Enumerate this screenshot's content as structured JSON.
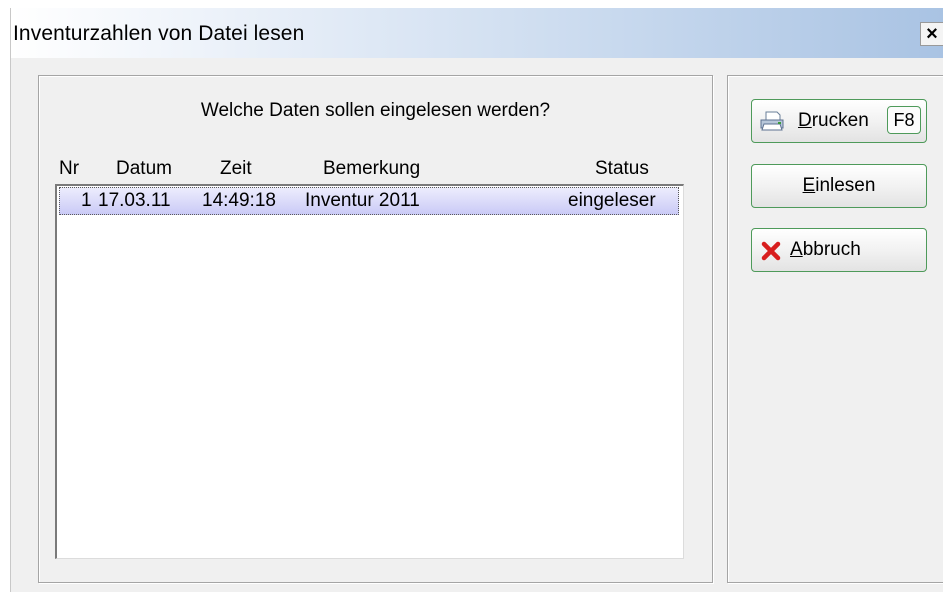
{
  "window": {
    "title": "Inventurzahlen von Datei lesen",
    "close_glyph": "×"
  },
  "main": {
    "question": "Welche Daten sollen eingelesen werden?",
    "columns": [
      "Nr",
      "Datum",
      "Zeit",
      "Bemerkung",
      "Status"
    ],
    "rows": [
      {
        "nr": "1",
        "datum": "17.03.11",
        "zeit": "14:49:18",
        "bemerkung": "Inventur 2011",
        "status": "eingeleser"
      }
    ]
  },
  "buttons": {
    "print": {
      "prefix": "D",
      "rest": "rucken",
      "shortcut": "F8",
      "icon": "printer-icon"
    },
    "read": {
      "prefix": "E",
      "rest": "inlesen"
    },
    "cancel": {
      "prefix": "A",
      "rest": "bbruch",
      "icon": "red-x-icon"
    }
  },
  "colors": {
    "selection_top": "#eeeefd",
    "selection_bottom": "#c9c9f6",
    "button_border": "#4e9a5a",
    "titlebar_end": "#a9c3e3",
    "cancel_icon": "#d81e1e"
  }
}
